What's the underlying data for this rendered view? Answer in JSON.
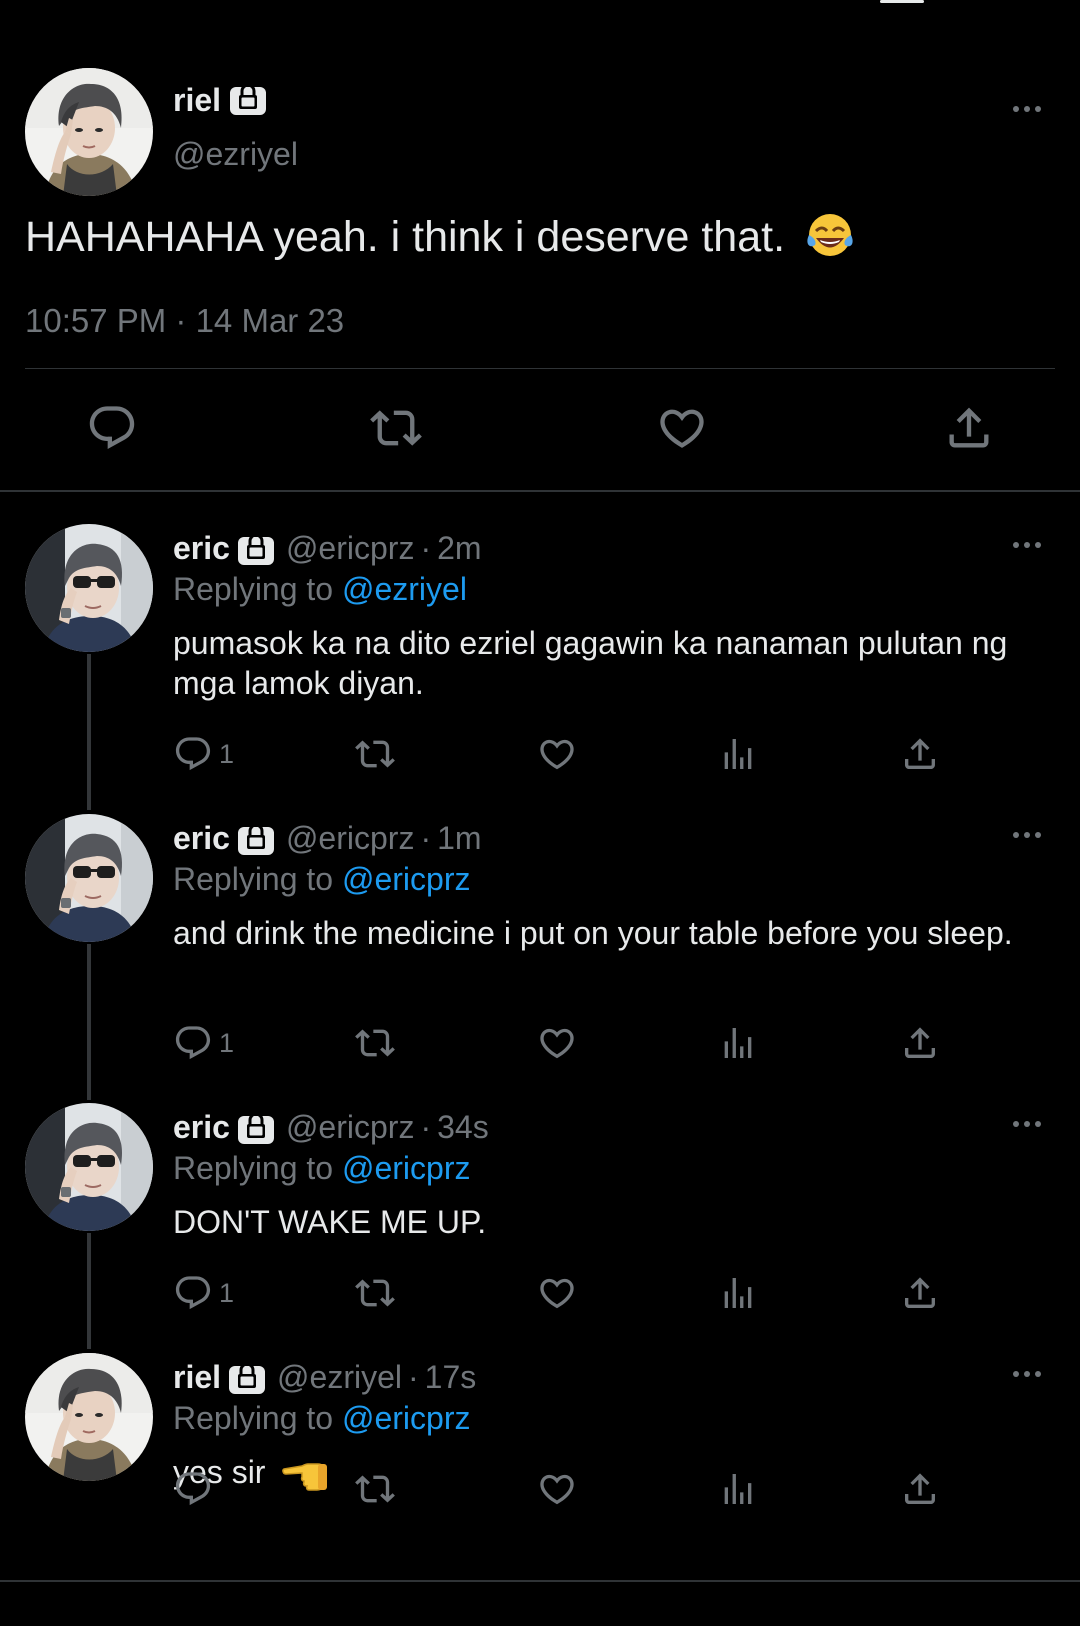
{
  "main_tweet": {
    "name": "riel",
    "handle": "@ezriyel",
    "text": "HAHAHAHA yeah. i think i deserve that.",
    "emoji": "face-with-tears-of-joy",
    "timestamp": "10:57 PM · 14 Mar 23",
    "actions": [
      "reply-icon",
      "retweet-icon",
      "like-icon",
      "share-icon"
    ]
  },
  "replies": [
    {
      "name": "eric",
      "handle": "@ericprz",
      "time": "2m",
      "replying_label": "Replying to",
      "replying_to": "@ezriyel",
      "text": "pumasok ka na dito ezriel gagawin ka nanaman pulutan ng mga lamok diyan.",
      "reply_count": "1"
    },
    {
      "name": "eric",
      "handle": "@ericprz",
      "time": "1m",
      "replying_label": "Replying to",
      "replying_to": "@ericprz",
      "text": "and drink the medicine i put on your table before you sleep.",
      "reply_count": "1"
    },
    {
      "name": "eric",
      "handle": "@ericprz",
      "time": "34s",
      "replying_label": "Replying to",
      "replying_to": "@ericprz",
      "text": "DON'T WAKE ME UP.",
      "reply_count": "1"
    },
    {
      "name": "riel",
      "handle": "@ezriyel",
      "time": "17s",
      "replying_label": "Replying to",
      "replying_to": "@ericprz",
      "text": "yes sir",
      "emoji": "backhand-index-pointing-left",
      "reply_count": ""
    }
  ],
  "separator": "·",
  "colors": {
    "background": "#000000",
    "text": "#e7e9ea",
    "muted": "#71767b",
    "link": "#1d9bf0",
    "divider": "#2f3336"
  }
}
